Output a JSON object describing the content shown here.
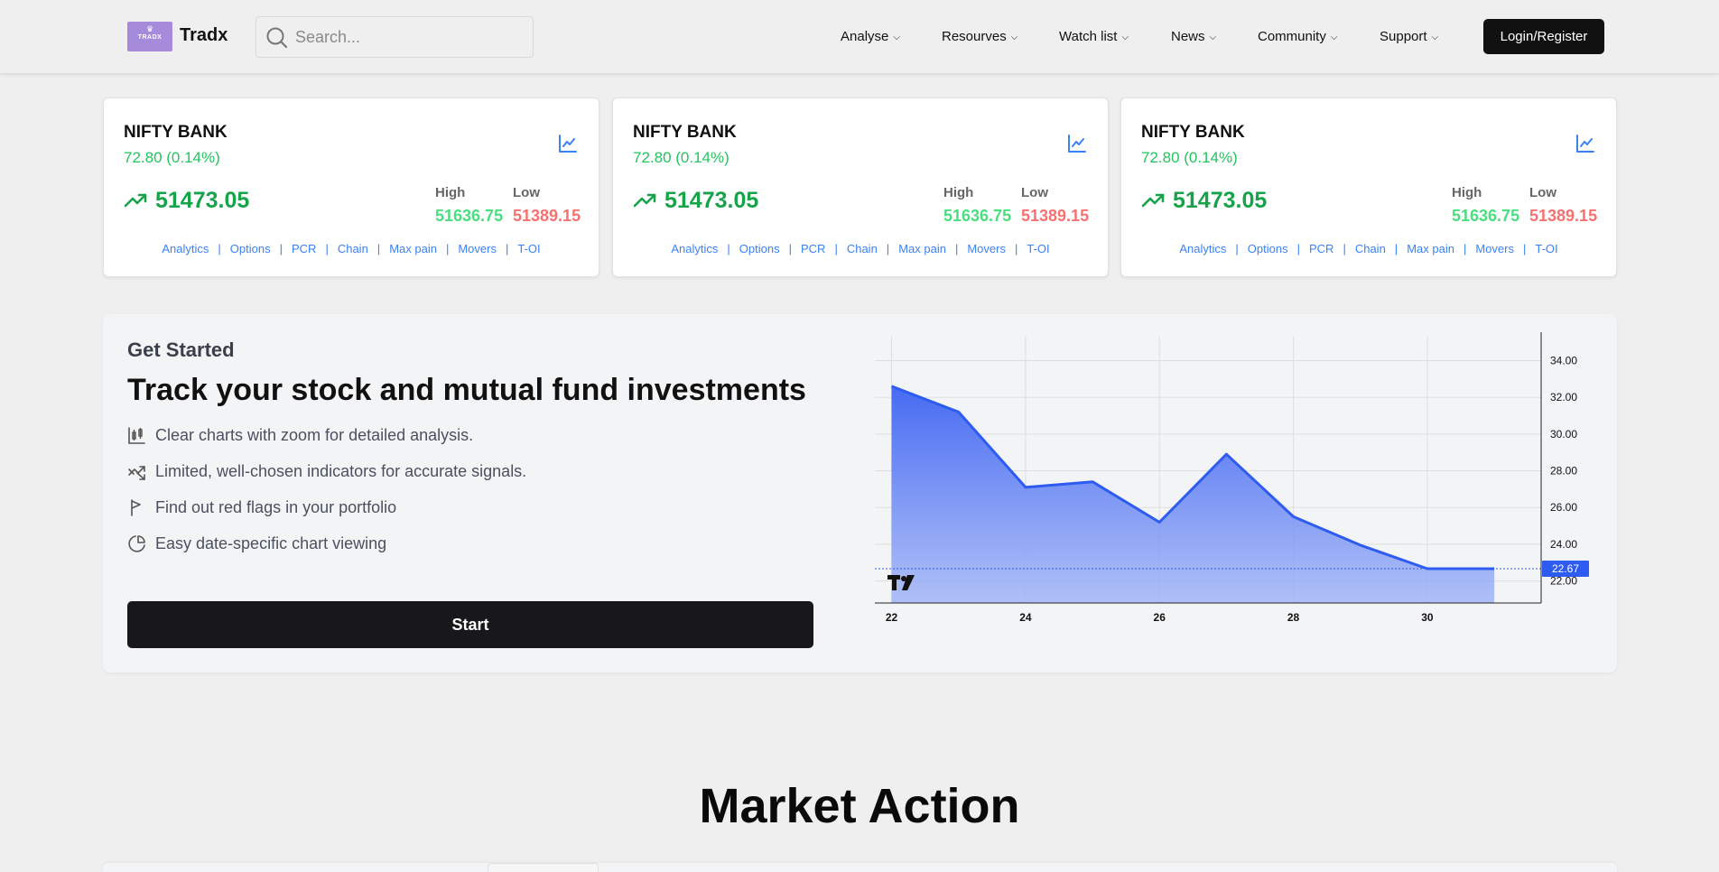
{
  "header": {
    "logo": {
      "text": "TRADX"
    },
    "brand": "Tradx",
    "search": {
      "placeholder": "Search..."
    },
    "nav": [
      {
        "label": "Analyse"
      },
      {
        "label": "Resourves"
      },
      {
        "label": "Watch list"
      },
      {
        "label": "News"
      },
      {
        "label": "Community"
      },
      {
        "label": "Support"
      }
    ],
    "login_label": "Login/Register"
  },
  "cards": [
    {
      "name": "NIFTY BANK",
      "change": "72.80 (0.14%)",
      "price": "51473.05",
      "high_label": "High",
      "high": "51636.75",
      "low_label": "Low",
      "low": "51389.15"
    },
    {
      "name": "NIFTY BANK",
      "change": "72.80 (0.14%)",
      "price": "51473.05",
      "high_label": "High",
      "high": "51636.75",
      "low_label": "Low",
      "low": "51389.15"
    },
    {
      "name": "NIFTY BANK",
      "change": "72.80 (0.14%)",
      "price": "51473.05",
      "high_label": "High",
      "high": "51636.75",
      "low_label": "Low",
      "low": "51389.15"
    }
  ],
  "card_links": [
    "Analytics",
    "Options",
    "PCR",
    "Chain",
    "Max pain",
    "Movers",
    "T-OI"
  ],
  "colors": {
    "positive": "#16a34a",
    "high": "#4ade80",
    "low": "#f87171",
    "link": "#3b82f6",
    "chart_line": "#2f5cf0"
  },
  "get_started": {
    "eyebrow": "Get Started",
    "headline": "Track your stock and mutual fund investments",
    "features": [
      {
        "icon": "candlestick-chart-icon",
        "text": "Clear charts with zoom for detailed analysis."
      },
      {
        "icon": "trending-arrows-icon",
        "text": "Limited, well-chosen indicators for accurate signals."
      },
      {
        "icon": "flag-icon",
        "text": "Find out red flags in your portfolio"
      },
      {
        "icon": "pie-chart-icon",
        "text": "Easy date-specific chart viewing"
      }
    ],
    "start_label": "Start"
  },
  "chart_data": {
    "type": "area",
    "x": [
      22,
      23,
      24,
      25,
      26,
      27,
      28,
      29,
      30,
      31
    ],
    "values": [
      32.6,
      31.2,
      27.1,
      27.4,
      25.2,
      28.9,
      25.5,
      23.95,
      22.67,
      22.67
    ],
    "x_ticks": [
      "22",
      "24",
      "26",
      "28",
      "30"
    ],
    "y_ticks": [
      "34.00",
      "32.00",
      "30.00",
      "28.00",
      "26.00",
      "24.00",
      "22.00"
    ],
    "ylim": [
      20.8,
      35.3
    ],
    "last_value_label": "22.67",
    "grid": true,
    "watermark": "TV"
  },
  "market_title": "Market Action"
}
